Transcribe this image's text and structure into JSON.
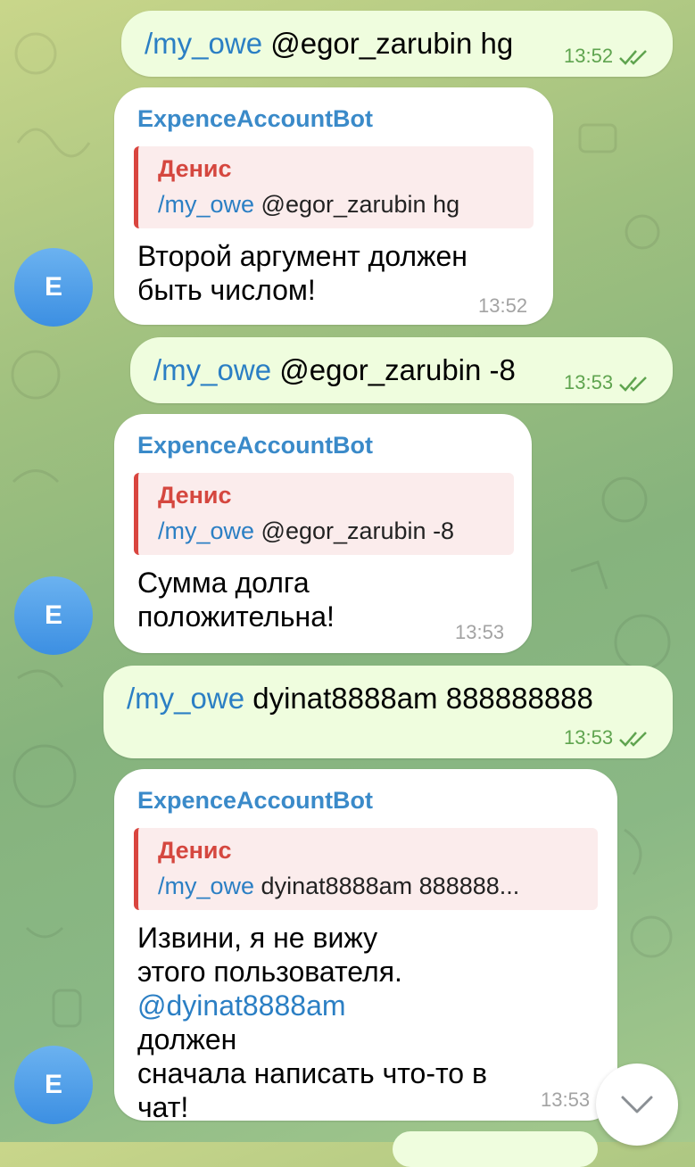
{
  "colors": {
    "outgoing_bubble": "#effdde",
    "incoming_bubble": "#ffffff",
    "command_link": "#2b7fc4",
    "sender_name": "#3a8ac9",
    "reply_name": "#d5473f",
    "reply_bar": "#d9453f",
    "outgoing_time": "#5fa44f",
    "avatar": "#3c8fe2"
  },
  "messages": [
    {
      "direction": "out",
      "command": "/my_owe",
      "args": " @egor_zarubin hg",
      "time": "13:52",
      "status_icon": "double-check-icon"
    },
    {
      "direction": "in",
      "sender": "ExpenceAccountBot",
      "avatar_letter": "E",
      "reply_author": "Денис",
      "reply_command": "/my_owe",
      "reply_args": " @egor_zarubin hg",
      "lines": [
        "Второй аргумент должен",
        "быть числом!"
      ],
      "time": "13:52"
    },
    {
      "direction": "out",
      "command": "/my_owe",
      "args": " @egor_zarubin -8",
      "time": "13:53",
      "status_icon": "double-check-icon"
    },
    {
      "direction": "in",
      "sender": "ExpenceAccountBot",
      "avatar_letter": "E",
      "reply_author": "Денис",
      "reply_command": "/my_owe",
      "reply_args": " @egor_zarubin -8",
      "lines": [
        "Сумма долга",
        "положительна!"
      ],
      "time": "13:53"
    },
    {
      "direction": "out",
      "command": "/my_owe",
      "args": " dyinat8888am 888888888",
      "time": "13:53",
      "status_icon": "double-check-icon"
    },
    {
      "direction": "in",
      "sender": "ExpenceAccountBot",
      "avatar_letter": "E",
      "reply_author": "Денис",
      "reply_command": "/my_owe",
      "reply_args": " dyinat8888am 888888...",
      "lines": [
        "Извини, я не вижу",
        "этого пользователя."
      ],
      "mention": "@dyinat8888am",
      "mention_rest": " должен",
      "lines_after": [
        "сначала написать что-то в",
        "чат!"
      ],
      "time": "13:53"
    }
  ],
  "scroll_button": {
    "icon": "chevron-down-icon"
  }
}
